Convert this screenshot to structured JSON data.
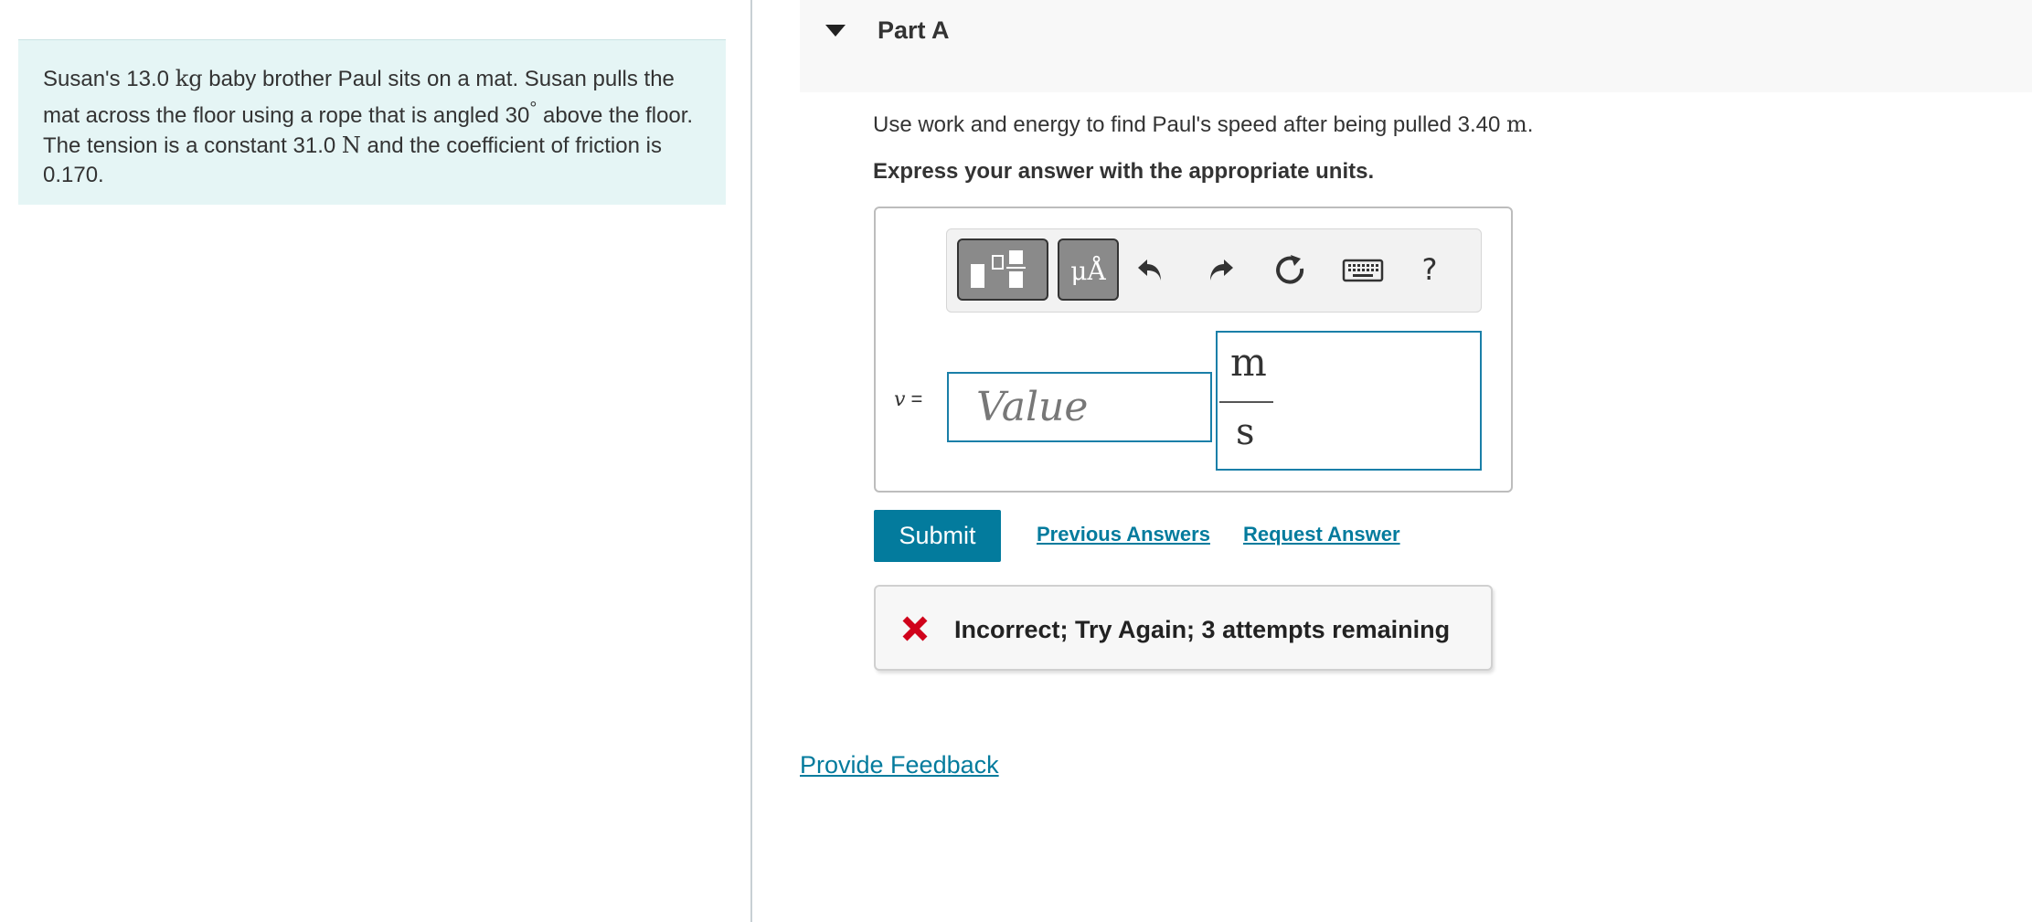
{
  "problem": {
    "text_1": "Susan's 13.0 ",
    "unit_kg": "kg",
    "text_2": " baby brother Paul sits on a mat. Susan pulls the mat across the floor using a rope that is angled 30",
    "degree": "°",
    "text_3": " above the floor. The tension is a constant 31.0 ",
    "unit_N": "N",
    "text_4": " and the coefficient of friction is 0.170."
  },
  "part": {
    "title": "Part A",
    "question_text": "Use work and energy to find Paul's speed after being pulled 3.40 ",
    "question_unit": "m",
    "question_end": ".",
    "instruction": "Express your answer with the appropriate units."
  },
  "toolbar": {
    "units_label": "μÅ",
    "help_label": "?"
  },
  "answer": {
    "variable": "v",
    "equals": " =",
    "value_placeholder": "Value",
    "value": "",
    "unit_numerator": "m",
    "unit_denominator": "s"
  },
  "actions": {
    "submit_label": "Submit",
    "previous_answers": "Previous Answers",
    "request_answer": "Request Answer"
  },
  "feedback": {
    "message": "Incorrect; Try Again; 3 attempts remaining",
    "status_color": "#d0021b"
  },
  "footer": {
    "provide_feedback": "Provide Feedback"
  },
  "colors": {
    "accent": "#037b9d",
    "problem_bg": "#e5f5f5",
    "header_bg": "#f8f8f8"
  }
}
